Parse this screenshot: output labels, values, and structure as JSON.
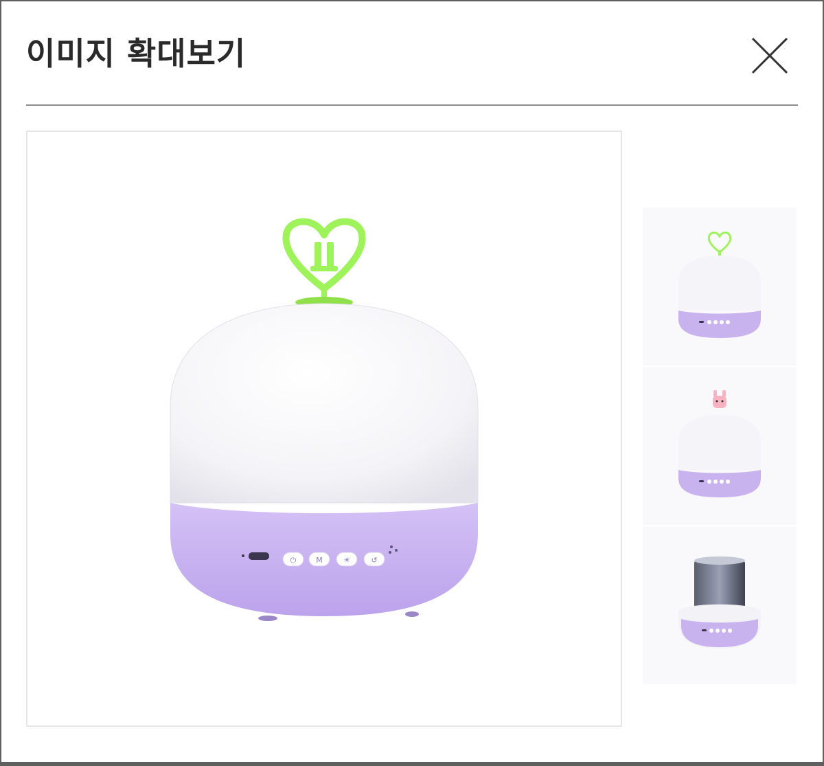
{
  "modal": {
    "title": "이미지 확대보기",
    "close_icon": "close-icon"
  },
  "main_image": {
    "alt": "product-lamp-heart-topper-purple",
    "button_labels": [
      "⏻",
      "M",
      "☀",
      "↺"
    ]
  },
  "thumbnails": [
    {
      "alt": "lamp-green-heart-topper"
    },
    {
      "alt": "lamp-pink-bunny-topper"
    },
    {
      "alt": "lamp-projector-cylinder"
    }
  ],
  "colors": {
    "border": "#5f5f5f",
    "divider": "#8c8c8c",
    "title": "#2a2a2a",
    "lamp_base": "#c9b3ef",
    "heart_green": "#9ef25a"
  }
}
